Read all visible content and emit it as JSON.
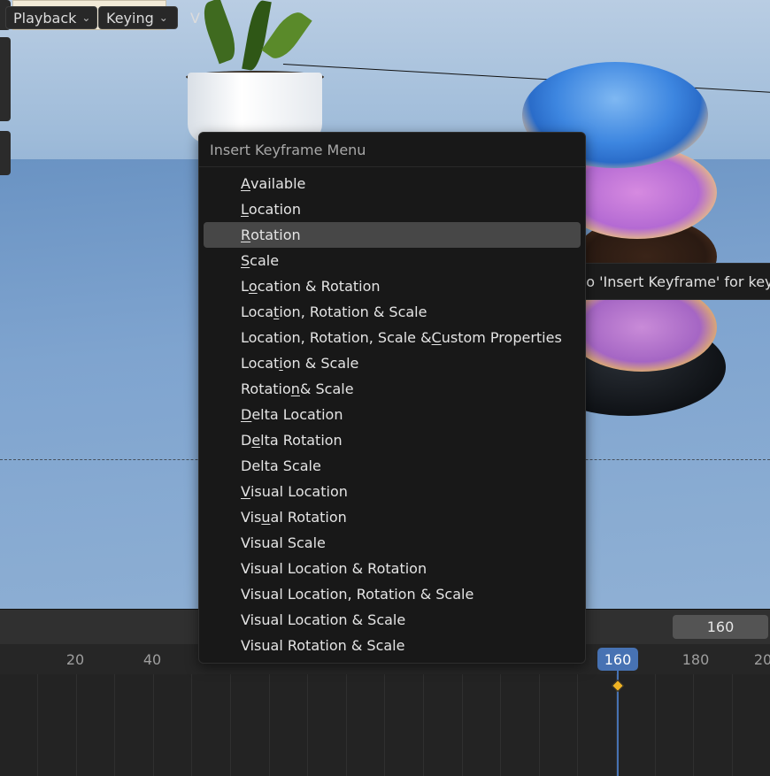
{
  "menu": {
    "title": "Insert Keyframe Menu",
    "items": [
      {
        "pre": "",
        "key": "A",
        "post": "vailable"
      },
      {
        "pre": "",
        "key": "L",
        "post": "ocation"
      },
      {
        "pre": "",
        "key": "R",
        "post": "otation"
      },
      {
        "pre": "",
        "key": "S",
        "post": "cale"
      },
      {
        "pre": "L",
        "key": "o",
        "post": "cation & Rotation"
      },
      {
        "pre": "Loca",
        "key": "t",
        "post": "ion, Rotation & Scale"
      },
      {
        "pre": "Location, Rotation, Scale & ",
        "key": "C",
        "post": "ustom Properties"
      },
      {
        "pre": "Locat",
        "key": "i",
        "post": "on & Scale"
      },
      {
        "pre": "Rotatio",
        "key": "n",
        "post": " & Scale"
      },
      {
        "pre": "",
        "key": "D",
        "post": "elta Location"
      },
      {
        "pre": "D",
        "key": "e",
        "post": "lta Rotation"
      },
      {
        "pre": "Delta Scale",
        "key": "",
        "post": ""
      },
      {
        "pre": "",
        "key": "V",
        "post": "isual Location"
      },
      {
        "pre": "Vis",
        "key": "u",
        "post": "al Rotation"
      },
      {
        "pre": "Visual Scale",
        "key": "",
        "post": ""
      },
      {
        "pre": "Visual Location & Rotation",
        "key": "",
        "post": ""
      },
      {
        "pre": "Visual Location, Rotation & Scale",
        "key": "",
        "post": ""
      },
      {
        "pre": "Visual Location & Scale",
        "key": "",
        "post": ""
      },
      {
        "pre": "Visual Rotation & Scale",
        "key": "",
        "post": ""
      }
    ],
    "active_index": 2
  },
  "tooltip": {
    "text": "Alternate access to 'Insert Keyframe' for key"
  },
  "timeline": {
    "playback_label": "Playback",
    "keying_label": "Keying",
    "view_label": "V",
    "frame_field_value": "160",
    "current_frame": "160",
    "tick_labels": [
      "20",
      "40",
      "180",
      "20"
    ],
    "playhead_color": "#4772b3",
    "keyframe_color": "#f0b323"
  },
  "icons": [
    "chevron-down-icon",
    "keyframe-diamond-icon"
  ]
}
